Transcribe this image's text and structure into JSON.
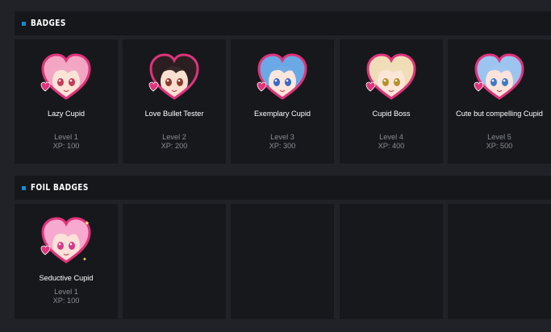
{
  "badges": {
    "title": "BADGES",
    "items": [
      {
        "name": "Lazy Cupid",
        "level": "Level 1",
        "xp": "XP: 100",
        "hair": "#f2a6c4",
        "skin": "#fbe3d8",
        "eye": "#c43a5a"
      },
      {
        "name": "Love Bullet Tester",
        "level": "Level 2",
        "xp": "XP: 200",
        "hair": "#2b1f22",
        "skin": "#fbe0d2",
        "eye": "#8a3a2a"
      },
      {
        "name": "Exemplary Cupid",
        "level": "Level 3",
        "xp": "XP: 300",
        "hair": "#6aa8e6",
        "skin": "#fbe6dc",
        "eye": "#3a6ac4"
      },
      {
        "name": "Cupid Boss",
        "level": "Level 4",
        "xp": "XP: 400",
        "hair": "#f0ddb8",
        "skin": "#fbe6d8",
        "eye": "#b8902a"
      },
      {
        "name": "Cute but compelling Cupid",
        "level": "Level 5",
        "xp": "XP: 500",
        "hair": "#9cc4ee",
        "skin": "#fbe3dc",
        "eye": "#3a7ac8"
      }
    ]
  },
  "foil_badges": {
    "title": "FOIL BADGES",
    "items": [
      {
        "name": "Seductive Cupid",
        "level": "Level 1",
        "xp": "XP: 100",
        "hair": "#f7a9cf",
        "skin": "#fbe1d8",
        "eye": "#d43a8a"
      }
    ],
    "empty_slots": 4
  },
  "colors": {
    "background": "#202227",
    "header_bg": "#15171b",
    "card_bg": "#16181c",
    "accent": "#1a8ad4",
    "heart_border": "#e0337a",
    "muted_text": "#8a8d93"
  }
}
